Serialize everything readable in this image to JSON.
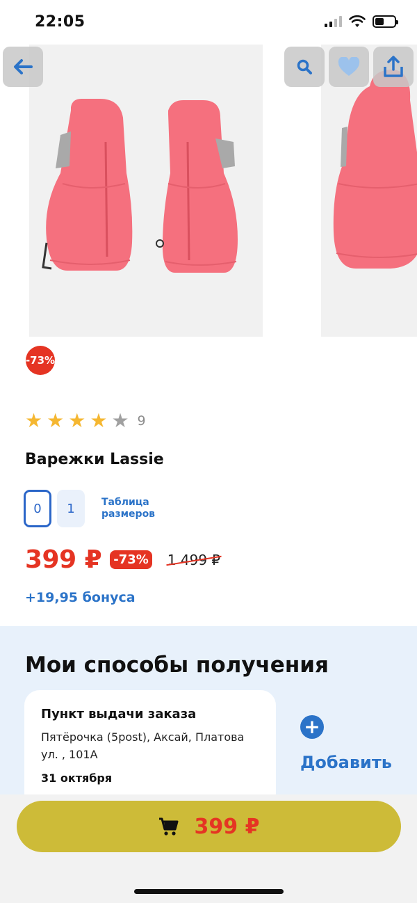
{
  "status": {
    "time": "22:05"
  },
  "nav": {
    "back_icon": "arrow-left-icon",
    "search_icon": "search-icon",
    "favorite_icon": "heart-icon",
    "share_icon": "share-icon"
  },
  "product": {
    "discount_badge": "-73%",
    "rating": 4,
    "rating_max": 5,
    "rating_count": "9",
    "title": "Варежки Lassie",
    "sizes": [
      "0",
      "1"
    ],
    "selected_size": "0",
    "size_table_label": "Таблица размеров",
    "price_current": "399 ₽",
    "price_discount": "-73%",
    "price_old": "1 499 ₽",
    "bonus": "+19,95 бонуса"
  },
  "delivery": {
    "title": "Мои способы получения",
    "pickup": {
      "title": "Пункт выдачи заказа",
      "address": "Пятёрочка (5post), Аксай, Платова ул. , 101А",
      "date": "31 октября"
    },
    "add_label": "Добавить"
  },
  "cart": {
    "price": "399 ₽",
    "icon": "cart-icon"
  },
  "colors": {
    "accent_blue": "#2b73c8",
    "price_red": "#e53423",
    "buy_button": "#cdbb38",
    "section_bg": "#e8f1fb",
    "star": "#f5b731"
  }
}
